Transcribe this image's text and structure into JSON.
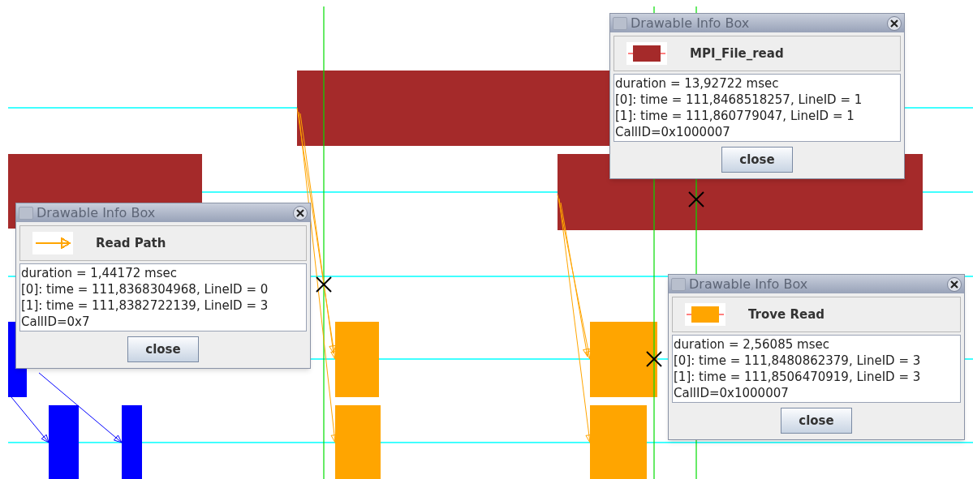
{
  "info_boxes": [
    {
      "title": "Drawable Info Box",
      "legend": {
        "kind": "state",
        "color": "#a52a2a",
        "name": "MPI_File_read"
      },
      "lines": [
        "duration = 13,92722 msec",
        "[0]: time = 111,8468518257, LineID = 1",
        "[1]: time = 111,860779047, LineID = 1",
        "CallID=0x1000007"
      ],
      "button": "close"
    },
    {
      "title": "Drawable Info Box",
      "legend": {
        "kind": "arrow",
        "color": "#ffa500",
        "name": "Read Path"
      },
      "lines": [
        "duration = 1,44172 msec",
        "[0]: time = 111,8368304968, LineID = 0",
        "[1]: time = 111,8382722139, LineID = 3",
        "CallID=0x7"
      ],
      "button": "close"
    },
    {
      "title": "Drawable Info Box",
      "legend": {
        "kind": "state",
        "color": "#ffa500",
        "name": "Trove Read"
      },
      "lines": [
        "duration = 2,56085 msec",
        "[0]: time = 111,8480862379, LineID = 3",
        "[1]: time = 111,8506470919, LineID = 3",
        "CallID=0x1000007"
      ],
      "button": "close"
    }
  ]
}
